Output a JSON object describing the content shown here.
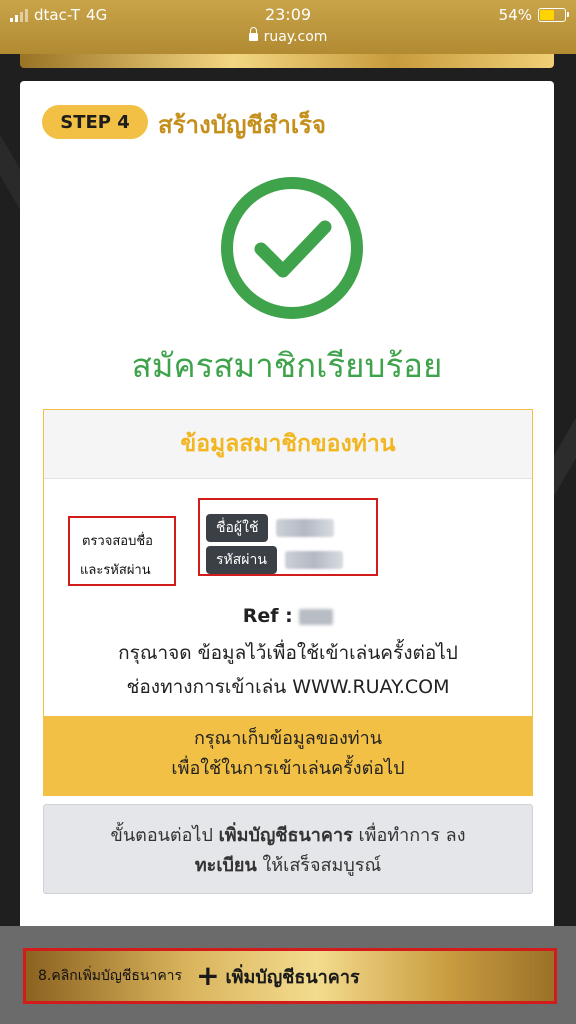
{
  "status_bar": {
    "carrier": "dtac-T",
    "network": "4G",
    "time": "23:09",
    "url": "ruay.com",
    "battery": "54%",
    "battery_level": 0.54
  },
  "step": {
    "badge": "STEP 4",
    "title": "สร้างบัญชีสำเร็จ"
  },
  "success": {
    "icon": "check-circle-icon",
    "message": "สมัครสมาชิกเรียบร้อย"
  },
  "info": {
    "heading": "ข้อมูลสมาชิกของท่าน",
    "note_line1": "ตรวจสอบชื่อ",
    "note_line2": "และรหัสผ่าน",
    "username_label": "ชื่อผู้ใช้",
    "password_label": "รหัสผ่าน",
    "ref_label": "Ref :",
    "remember_text": "กรุณาจด ข้อมูลไว้เพื่อใช้เข้าเล่นครั้งต่อไป",
    "channel_text": "ช่องทางการเข้าเล่น WWW.RUAY.COM",
    "keep_line1": "กรุณาเก็บข้อมูลของท่าน",
    "keep_line2": "เพื่อใช้ในการเข้าเล่นครั้งต่อไป"
  },
  "next": {
    "prefix": "ขั้นตอนต่อไป",
    "emphasis": "เพิ่มบัญชีธนาคาร",
    "suffix": "เพื่อทำการ ลง",
    "line2_emphasis": "ทะเบียน",
    "line2_suffix": "ให้เสร็จสมบูรณ์"
  },
  "bottom": {
    "step_note": "8.คลิกเพิ่มบัญชีธนาคาร",
    "plus": "+",
    "button_label": "เพิ่มบัญชีธนาคาร"
  },
  "colors": {
    "gold": "#f2c044",
    "success_green": "#3fa34b",
    "highlight_red": "#d21b1b"
  }
}
